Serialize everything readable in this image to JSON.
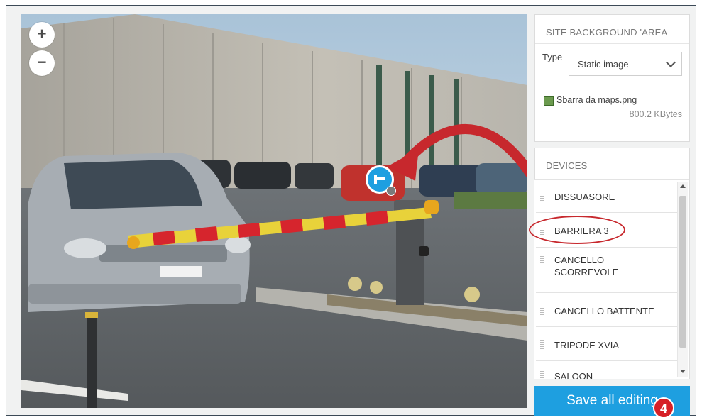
{
  "map": {
    "zoom_in": "+",
    "zoom_out": "−",
    "device_marker_icon": "barrier-icon"
  },
  "background": {
    "title": "SITE BACKGROUND 'AREA",
    "type_label": "Type",
    "type_value": "Static image",
    "file_name": "Sbarra da maps.png",
    "file_size": "800.2 KBytes"
  },
  "devices": {
    "title": "DEVICES",
    "items": [
      {
        "label": "DISSUASORE"
      },
      {
        "label": "BARRIERA 3"
      },
      {
        "label": "CANCELLO SCORREVOLE"
      },
      {
        "label": "CANCELLO BATTENTE"
      },
      {
        "label": "TRIPODE XVIA"
      },
      {
        "label": "SALOON"
      }
    ]
  },
  "save_button": "Save all editing",
  "step_badge": "4",
  "colors": {
    "accent": "#1e9fe0",
    "annotation_red": "#d62027"
  }
}
